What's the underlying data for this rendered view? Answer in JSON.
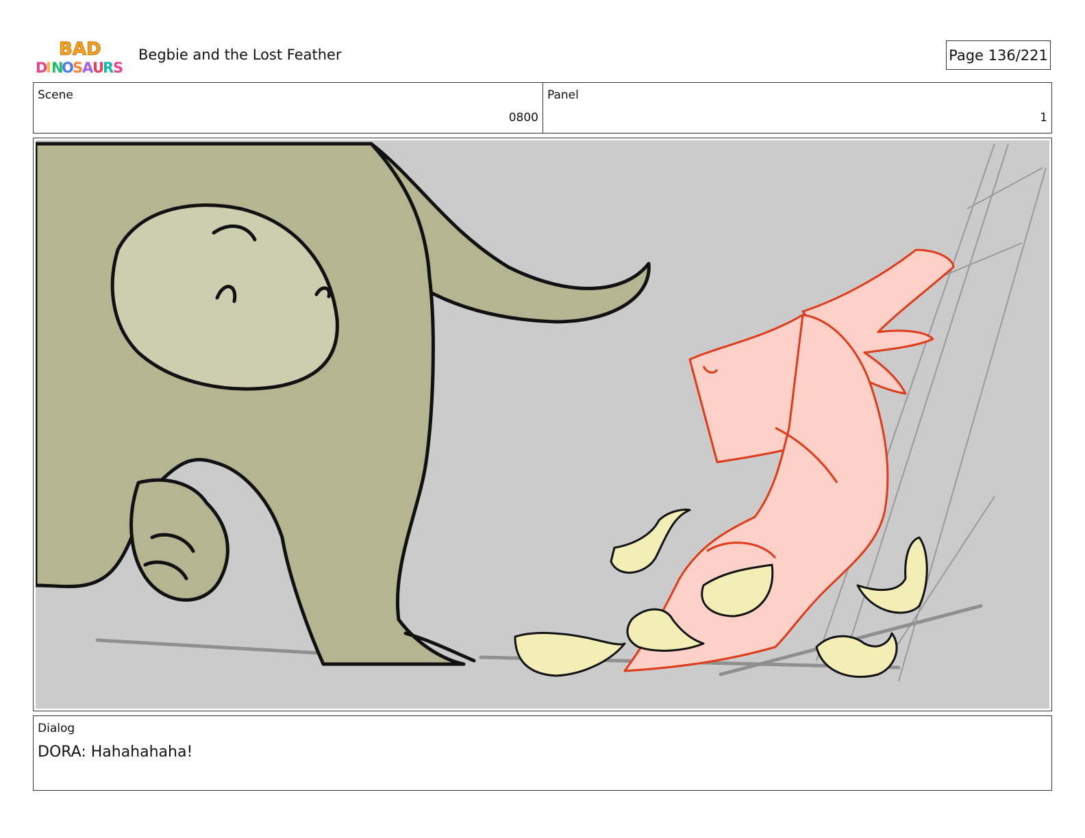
{
  "header": {
    "logo_text": "BAD DINOSAURS",
    "title": "Begbie and the Lost Feather",
    "page": "Page 136/221"
  },
  "info": {
    "scene_label": "Scene",
    "scene_value": "0800",
    "panel_label": "Panel",
    "panel_value": "1"
  },
  "dialog": {
    "label": "Dialog",
    "text": "DORA: Hahahahaha!"
  },
  "colors": {
    "background": "#cbcbcb",
    "dino_body": "#b5b591",
    "dino_belly": "#cdcdb0",
    "pink_dino_fill": "#fdd0c8",
    "pink_dino_line": "#e03a18",
    "chips": "#f3edb6",
    "outline": "#111111"
  }
}
